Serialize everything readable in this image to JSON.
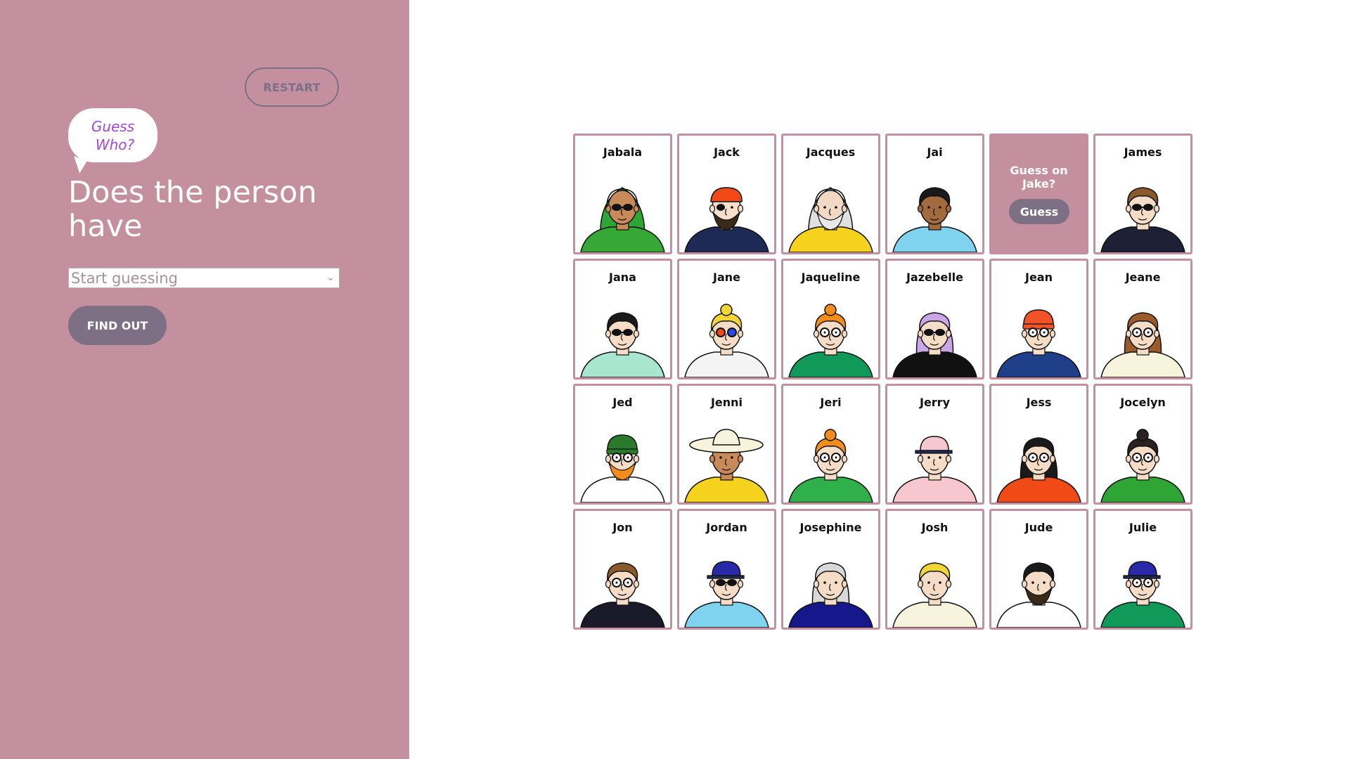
{
  "sidebar": {
    "restart_label": "RESTART",
    "logo": {
      "line1": "Guess",
      "line2": "Who?"
    },
    "question": "Does the person have",
    "select": {
      "value": "Start guessing"
    },
    "find_out_label": "FIND OUT"
  },
  "guess_card": {
    "line1": "Guess on",
    "line2": "Jake?",
    "button_label": "Guess"
  },
  "cards": [
    {
      "name": "Jabala",
      "skin": "#c98a5a",
      "hair": "#2fa535",
      "shirt": "#36a836",
      "glasses": "sun",
      "hat": "hijab"
    },
    {
      "name": "Jack",
      "skin": "#f6dfcb",
      "hair": "#7a4a1e",
      "shirt": "#1d2a55",
      "glasses": "patch",
      "hat": "bandana",
      "beard": true
    },
    {
      "name": "Jacques",
      "skin": "#f2d9c4",
      "hair": "#e0e0e0",
      "shirt": "#f5d21d",
      "glasses": "none",
      "hat": "hood",
      "beard": true
    },
    {
      "name": "Jai",
      "skin": "#a36a3e",
      "hair": "#1a1a1a",
      "shirt": "#7fd3ee",
      "glasses": "none",
      "hat": "none"
    },
    {
      "name": "GUESS"
    },
    {
      "name": "James",
      "skin": "#f4dcc6",
      "hair": "#8a5a2b",
      "shirt": "#1e2035",
      "glasses": "sun",
      "hat": "none"
    },
    {
      "name": "Jana",
      "skin": "#f4dcc6",
      "hair": "#1a1a1a",
      "shirt": "#a8e6cf",
      "glasses": "sun",
      "hat": "none"
    },
    {
      "name": "Jane",
      "skin": "#f4dcc6",
      "hair": "#f2d636",
      "shirt": "#f4f4f4",
      "glasses": "color",
      "hat": "none"
    },
    {
      "name": "Jaqueline",
      "skin": "#f4dcc6",
      "hair": "#f28c1a",
      "shirt": "#11995a",
      "glasses": "round",
      "hat": "none"
    },
    {
      "name": "Jazebelle",
      "skin": "#f4dcc6",
      "hair": "#c9a6e8",
      "shirt": "#111111",
      "glasses": "sun",
      "hat": "none"
    },
    {
      "name": "Jean",
      "skin": "#f4dcc6",
      "hair": "#f0522a",
      "shirt": "#1f3f8a",
      "glasses": "round",
      "hat": "beanie"
    },
    {
      "name": "Jeane",
      "skin": "#f4dcc6",
      "hair": "#9a5a2a",
      "shirt": "#f7f3dc",
      "glasses": "round",
      "hat": "none"
    },
    {
      "name": "Jed",
      "skin": "#f4dcc6",
      "hair": "#2b7a2b",
      "shirt": "#ffffff",
      "glasses": "round",
      "hat": "beanie",
      "beard": true
    },
    {
      "name": "Jenni",
      "skin": "#c98a5a",
      "hair": "#3a2a1a",
      "shirt": "#f5d21d",
      "glasses": "none",
      "hat": "sunhat"
    },
    {
      "name": "Jeri",
      "skin": "#f4dcc6",
      "hair": "#f28c1a",
      "shirt": "#2fb04a",
      "glasses": "round",
      "hat": "none"
    },
    {
      "name": "Jerry",
      "skin": "#f4dcc6",
      "hair": "#f7c7cf",
      "shirt": "#f7c7cf",
      "glasses": "none",
      "hat": "cap"
    },
    {
      "name": "Jess",
      "skin": "#f4dcc6",
      "hair": "#1a1a1a",
      "shirt": "#f04a16",
      "glasses": "round",
      "hat": "none"
    },
    {
      "name": "Jocelyn",
      "skin": "#f4dcc6",
      "hair": "#2a2222",
      "shirt": "#2fa535",
      "glasses": "round",
      "hat": "none"
    },
    {
      "name": "Jon",
      "skin": "#f4dcc6",
      "hair": "#8a5a2b",
      "shirt": "#1a1a2a",
      "glasses": "round",
      "hat": "none"
    },
    {
      "name": "Jordan",
      "skin": "#f4dcc6",
      "hair": "#f2d636",
      "shirt": "#7fd3ee",
      "glasses": "sun",
      "hat": "cap"
    },
    {
      "name": "Josephine",
      "skin": "#f4dcc6",
      "hair": "#d8d8d8",
      "shirt": "#15178a",
      "glasses": "none",
      "hat": "none"
    },
    {
      "name": "Josh",
      "skin": "#f4dcc6",
      "hair": "#f2d636",
      "shirt": "#f7f3dc",
      "glasses": "none",
      "hat": "none"
    },
    {
      "name": "Jude",
      "skin": "#f4dcc6",
      "hair": "#1a1a1a",
      "shirt": "#ffffff",
      "glasses": "none",
      "hat": "none",
      "beard": true
    },
    {
      "name": "Julie",
      "skin": "#f4dcc6",
      "hair": "#2a2222",
      "shirt": "#11995a",
      "glasses": "round",
      "hat": "cap"
    }
  ],
  "colors": {
    "sidebar": "#c4909f",
    "button": "#7d7085",
    "logo_text": "#a148d8"
  }
}
